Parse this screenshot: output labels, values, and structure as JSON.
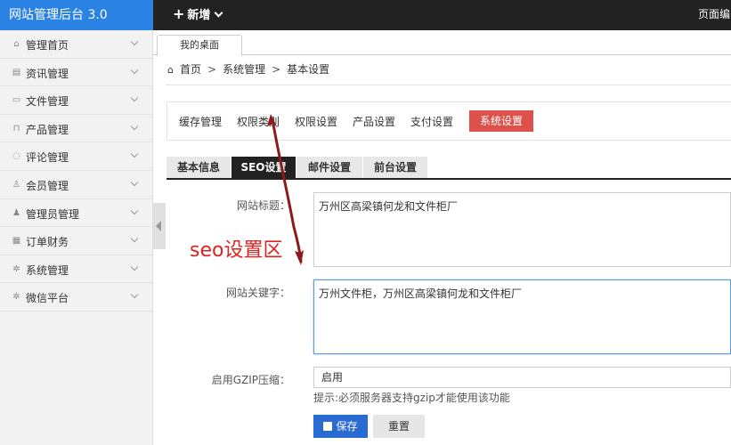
{
  "header": {
    "brand": "网站管理后台 3.0",
    "new_label": "新增",
    "right_text": "页面编"
  },
  "sidebar": {
    "items": [
      {
        "label": "管理首页",
        "icon": "home-icon",
        "glyph": "⌂"
      },
      {
        "label": "资讯管理",
        "icon": "news-icon",
        "glyph": "▤"
      },
      {
        "label": "文件管理",
        "icon": "image-icon",
        "glyph": "▭"
      },
      {
        "label": "产品管理",
        "icon": "product-icon",
        "glyph": "⊓"
      },
      {
        "label": "评论管理",
        "icon": "comment-icon",
        "glyph": "◌"
      },
      {
        "label": "会员管理",
        "icon": "member-icon",
        "glyph": "♙"
      },
      {
        "label": "管理员管理",
        "icon": "admin-icon",
        "glyph": "♟"
      },
      {
        "label": "订单财务",
        "icon": "order-icon",
        "glyph": "▦"
      },
      {
        "label": "系统管理",
        "icon": "cog-icon",
        "glyph": "✲"
      },
      {
        "label": "微信平台",
        "icon": "wechat-icon",
        "glyph": "✲"
      }
    ]
  },
  "tabs": {
    "desk": "我的桌面"
  },
  "breadcrumb": {
    "home": "首页",
    "level1": "系统管理",
    "level2": "基本设置",
    "sep": ">"
  },
  "settings_nav": {
    "items": [
      "缓存管理",
      "权限类别",
      "权限设置",
      "产品设置",
      "支付设置"
    ],
    "active": "系统设置"
  },
  "sub_tabs": {
    "items": [
      "基本信息",
      "SEO设置",
      "邮件设置",
      "前台设置"
    ],
    "active_index": 1
  },
  "form": {
    "title_label": "网站标题：",
    "title_value": "万州区高梁镇何龙和文件柜厂",
    "keywords_label": "网站关键字：",
    "keywords_value": "万州文件柜，万州区高梁镇何龙和文件柜厂",
    "gzip_label": "启用GZIP压缩：",
    "gzip_value": "启用",
    "hint": "提示:必须服务器支持gzip才能使用该功能",
    "save_label": "保存",
    "reset_label": "重置"
  },
  "annotation": {
    "text": "seo设置区",
    "color": "#dd2222"
  },
  "colors": {
    "brand_blue": "#2a82e4",
    "active_red": "#dd514c",
    "save_blue": "#2a6bd1",
    "topbar": "#222222"
  }
}
